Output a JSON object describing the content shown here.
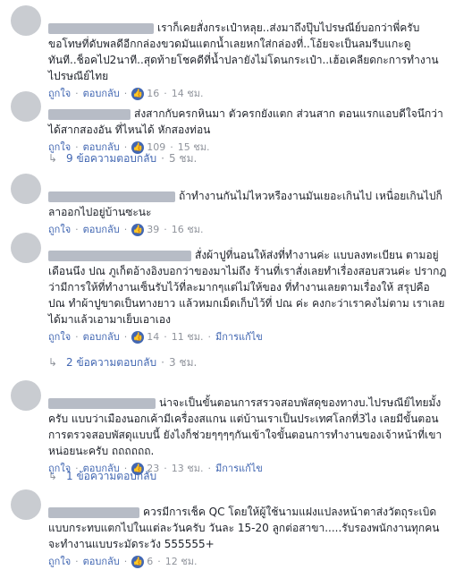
{
  "comments": [
    {
      "text": "เราก็เคยสั่งกระเป๋าหลุย..ส่งมาถึงปุ๊บไปรษณีย์บอกว่าพี่ครับขอโทษที่ดับพลดีอีกกล่องขวดมันแตกน้ำเลยหกใส่กล่องที่..โอ้ยจะเป็นลมรีบแกะดูทันที..ช็อคไป2นาที..สุดท้ายโชคดีที่น้ำปลายังไม่โดนกระเป๋า..เฮ้อเคลียดกะการทำงานไปรษณีย์ไทย",
      "like": "ถูกใจ",
      "reply": "ตอบกลับ",
      "reactions": "16",
      "time": "14 ชม."
    },
    {
      "text": "ส่งสากกับครกหินมา ตัวครกยังแตก ส่วนสาก ตอนแรกแอบดีใจนึกว่าได้สากสองอัน ที่ไหนได้ หักสองท่อน",
      "like": "ถูกใจ",
      "reply": "ตอบกลับ",
      "reactions": "109",
      "time": "15 ชม.",
      "replies_label": "9 ข้อความตอบกลับ",
      "replies_time": "5 ชม."
    },
    {
      "text": "ถ้าทำงานกันไม่ไหวหรืองานมันเยอะเกินไป เหนื่อยเกินไปก็ลาออกไปอยู่บ้านซะนะ",
      "like": "ถูกใจ",
      "reply": "ตอบกลับ",
      "reactions": "39",
      "time": "16 ชม."
    },
    {
      "text": "สั่งผ้าปูที่นอนให้ส่งที่ทำงานค่ะ แบบลงทะเบียน ตามอยู่เดือนนึง ปณ ภูเก็ตอ้างอิงบอกว่าของมาไม่ถึง ร้านที่เราสั่งเลยทำเรื่องสอบสวนค่ะ ปรากฎว่ามีการให้ที่ทำงานเซ็นรับไว้ที่ละมากๆแต่ไม่ให้ของ ที่ทำงานเลยตามเรื่องให้ สรุปคือ ปณ ทำผ้าปูขาดเป็นทางยาว แล้วหมกเม็ดเก็บไว้ที่ ปณ ค่ะ คงกะว่าเราคงไม่ตาม เราเลยได้มาแล้วเอามาเย็บเอาเอง",
      "like": "ถูกใจ",
      "reply": "ตอบกลับ",
      "reactions": "14",
      "time": "11 ชม.",
      "edited": "มีการแก้ไข",
      "replies_label": "2 ข้อความตอบกลับ",
      "replies_time": "3 ชม."
    },
    {
      "text": "น่าจะเป็นขั้นตอนการสรวจสอบพัสดุของทางบ.ไปรษณีย์ไทยมั้งครับ แบบว่าเมืองนอกเค้ามีเครื่องสแกน แต่บ้านเราเป็นประเทศโลกที่3ไง เลยมีขั้นตอนการตรวจสอบพัสดุแบบนี้ ยังไงก็ช่วยๆๆๆๆกันเข้าใจขั้นตอนการทำงานของเจ้าหน้าที่เขาหน่อยนะครับ ถถถถถถ.",
      "like": "ถูกใจ",
      "reply": "ตอบกลับ",
      "reactions": "23",
      "time": "13 ชม.",
      "edited": "มีการแก้ไข",
      "replies_label": "1 ข้อความตอบกลับ"
    },
    {
      "text": "ควรมีการเช็ค QC โดยให้ผู้ใช้นามแฝงแปลงหน้าตาส่งวัตถุระเบิดแบบกระทบแตกไปในแต่ละวันครับ วันละ 15-20 ลูกต่อสาขา.....รับรองพนักงานทุกคนจะทำงานแบบระมัดระวัง 555555+",
      "like": "ถูกใจ",
      "reply": "ตอบกลับ",
      "reactions": "6",
      "time": "12 ชม."
    }
  ],
  "colors": {
    "link": "#4267b2",
    "meta": "#90949c",
    "text": "#1d2129",
    "reaction": "#4267b2"
  },
  "icons": {
    "like_reaction": "thumbs-up-icon",
    "reply_arrow": "reply-arrow-icon"
  }
}
